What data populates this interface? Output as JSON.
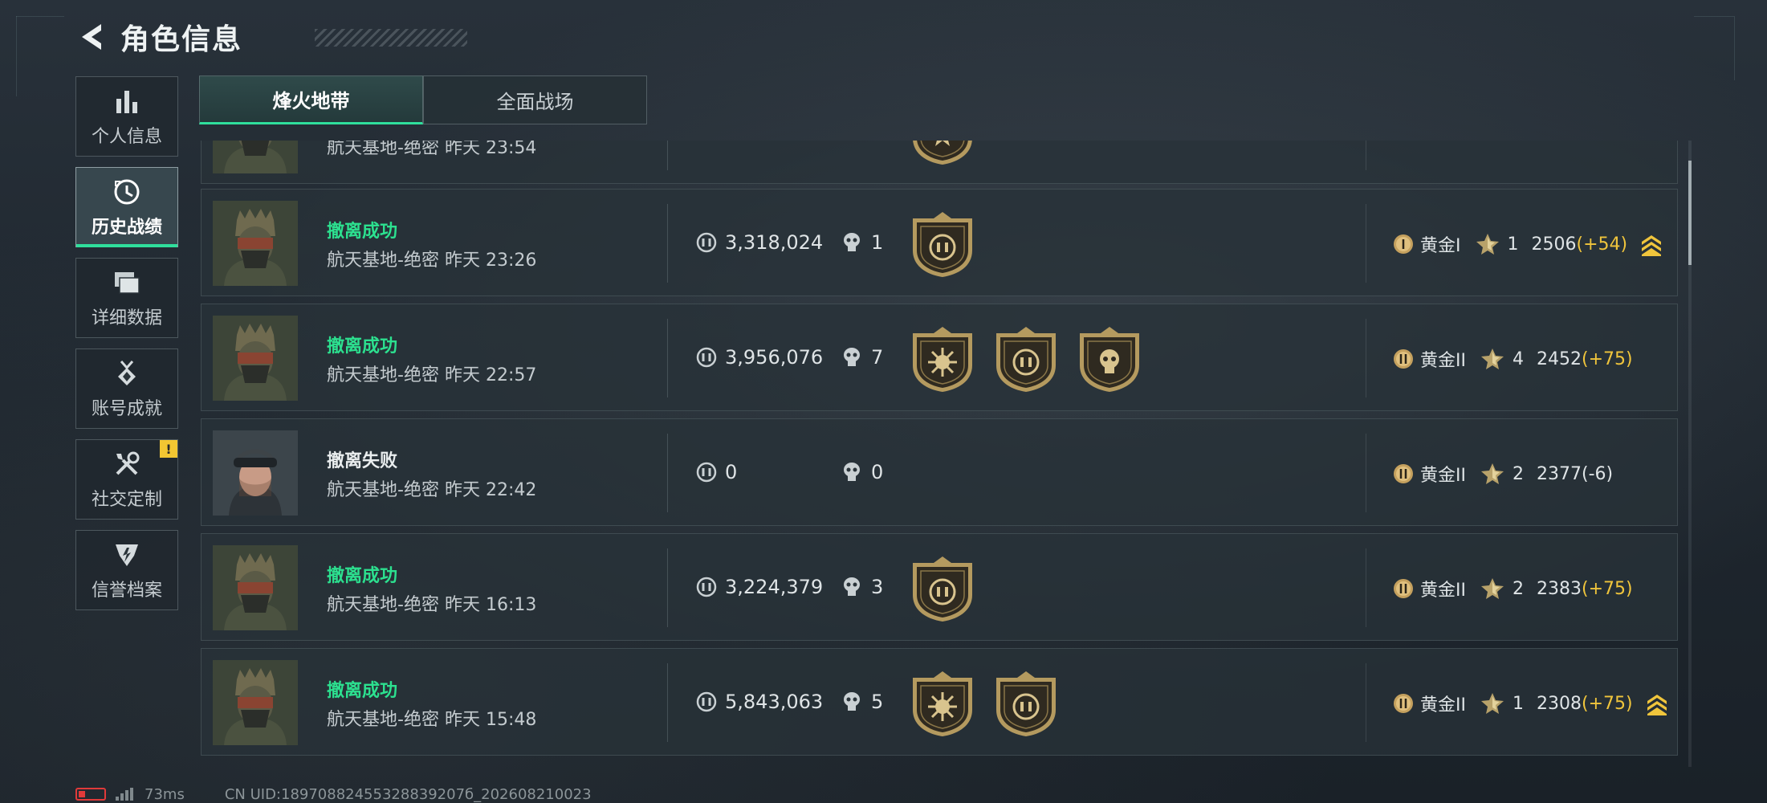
{
  "header": {
    "title": "角色信息"
  },
  "sidebar": {
    "items": [
      {
        "label": "个人信息",
        "icon": "bar-chart-icon",
        "active": false
      },
      {
        "label": "历史战绩",
        "icon": "history-clock-icon",
        "active": true
      },
      {
        "label": "详细数据",
        "icon": "folder-stack-icon",
        "active": false
      },
      {
        "label": "账号成就",
        "icon": "achievement-medal-icon",
        "active": false
      },
      {
        "label": "社交定制",
        "icon": "tools-icon",
        "active": false,
        "badge": "!"
      },
      {
        "label": "信誉档案",
        "icon": "shield-emblem-icon",
        "active": false
      }
    ]
  },
  "tabs": [
    {
      "label": "烽火地带",
      "active": true
    },
    {
      "label": "全面战场",
      "active": false
    }
  ],
  "records": [
    {
      "status": "",
      "map": "航天基地-绝密",
      "time": "昨天 23:54",
      "money": "",
      "kills": "",
      "medals": [
        "star-medal"
      ],
      "rank": "",
      "stars": "",
      "score": "",
      "change": "",
      "streak": false,
      "avatar": "operator-helmet"
    },
    {
      "status": "撤离成功",
      "map": "航天基地-绝密",
      "time": "昨天 23:26",
      "money": "3,318,024",
      "kills": "1",
      "medals": [
        "coin-medal"
      ],
      "rank_tier": "I",
      "rank": "黄金I",
      "stars": "1",
      "score": "2506",
      "change": "(+54)",
      "streak": true,
      "avatar": "operator-helmet"
    },
    {
      "status": "撤离成功",
      "map": "航天基地-绝密",
      "time": "昨天 22:57",
      "money": "3,956,076",
      "kills": "7",
      "medals": [
        "sun-medal",
        "coin-medal",
        "skull-medal"
      ],
      "rank_tier": "II",
      "rank": "黄金II",
      "stars": "4",
      "score": "2452",
      "change": "(+75)",
      "streak": false,
      "avatar": "operator-helmet"
    },
    {
      "status": "撤离失败",
      "map": "航天基地-绝密",
      "time": "昨天 22:42",
      "money": "0",
      "kills": "0",
      "medals": [],
      "rank_tier": "II",
      "rank": "黄金II",
      "stars": "2",
      "score": "2377",
      "change": "(-6)",
      "streak": false,
      "avatar": "operator-female"
    },
    {
      "status": "撤离成功",
      "map": "航天基地-绝密",
      "time": "昨天 16:13",
      "money": "3,224,379",
      "kills": "3",
      "medals": [
        "coin-medal"
      ],
      "rank_tier": "II",
      "rank": "黄金II",
      "stars": "2",
      "score": "2383",
      "change": "(+75)",
      "streak": false,
      "avatar": "operator-helmet"
    },
    {
      "status": "撤离成功",
      "map": "航天基地-绝密",
      "time": "昨天 15:48",
      "money": "5,843,063",
      "kills": "5",
      "medals": [
        "sun-medal",
        "coin-medal"
      ],
      "rank_tier": "II",
      "rank": "黄金II",
      "stars": "1",
      "score": "2308",
      "change": "(+75)",
      "streak": true,
      "avatar": "operator-helmet"
    }
  ],
  "statusbar": {
    "ping": "73ms",
    "uid": "CN UID:18970882455328839207б_202608210023"
  },
  "colors": {
    "success": "#2ce08f",
    "accent": "#2fdf9c",
    "gold": "#f0c53c"
  }
}
